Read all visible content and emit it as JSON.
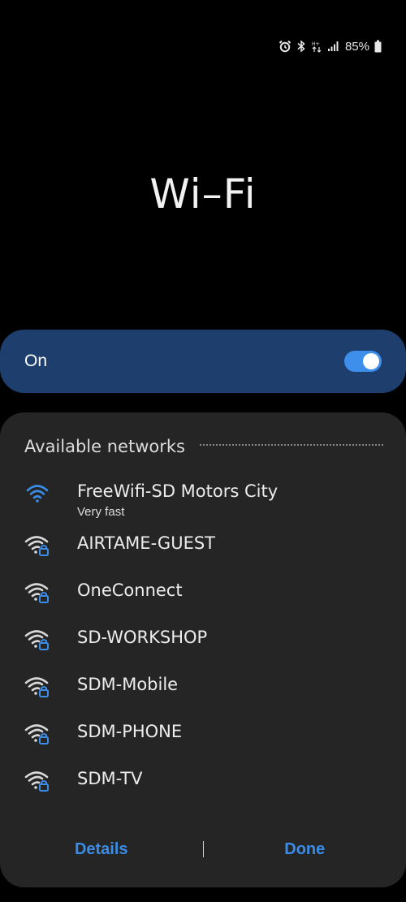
{
  "status_bar": {
    "icons": [
      "alarm-icon",
      "bluetooth-icon",
      "data-arrows-icon",
      "signal-icon",
      "battery-icon"
    ],
    "battery_percent": "85%"
  },
  "page": {
    "title": "Wi–Fi"
  },
  "toggle": {
    "label": "On",
    "state": "on",
    "accent_color": "#3e8eec"
  },
  "networks_section": {
    "title": "Available networks",
    "items": [
      {
        "name": "FreeWifi-SD Motors City",
        "subtitle": "Very fast",
        "secured": false,
        "icon": "wifi-icon",
        "color": "#3b8ce6"
      },
      {
        "name": "AIRTAME-GUEST",
        "secured": true,
        "icon": "wifi-lock-icon"
      },
      {
        "name": "OneConnect",
        "secured": true,
        "icon": "wifi-lock-icon"
      },
      {
        "name": "SD-WORKSHOP",
        "secured": true,
        "icon": "wifi-lock-icon"
      },
      {
        "name": "SDM-Mobile",
        "secured": true,
        "icon": "wifi-lock-icon"
      },
      {
        "name": "SDM-PHONE",
        "secured": true,
        "icon": "wifi-lock-icon"
      },
      {
        "name": "SDM-TV",
        "secured": true,
        "icon": "wifi-lock-icon"
      }
    ]
  },
  "buttons": {
    "details": "Details",
    "done": "Done",
    "color": "#3b8ce6"
  },
  "colors": {
    "background": "#000000",
    "toggle_card": "#1e3f6e",
    "panel": "#252526"
  }
}
